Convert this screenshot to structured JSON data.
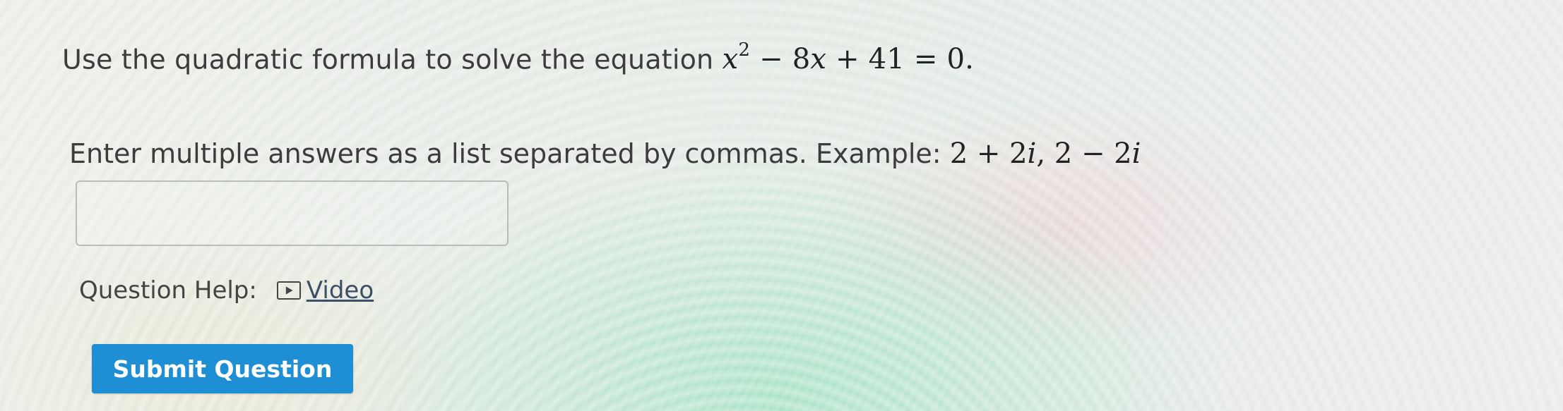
{
  "question": {
    "prompt_prefix": "Use the quadratic formula to solve the equation ",
    "equation": {
      "base": "x",
      "exponent": "2",
      "rest": " − 8",
      "var": "x",
      "tail": " + 41 = 0."
    }
  },
  "instructions": {
    "text": "Enter multiple answers as a list separated by commas. Example: ",
    "example": {
      "a1": "2 + 2",
      "i1": "i",
      "sep": ", 2 − 2",
      "i2": "i"
    }
  },
  "answer_input": {
    "value": "",
    "placeholder": ""
  },
  "help": {
    "label": "Question Help:",
    "video_link": "Video",
    "video_icon": "play-icon"
  },
  "submit": {
    "label": "Submit Question"
  },
  "colors": {
    "submit_button": "#1e8fd4",
    "link": "#3d4f66",
    "text": "#3c3c3c"
  }
}
